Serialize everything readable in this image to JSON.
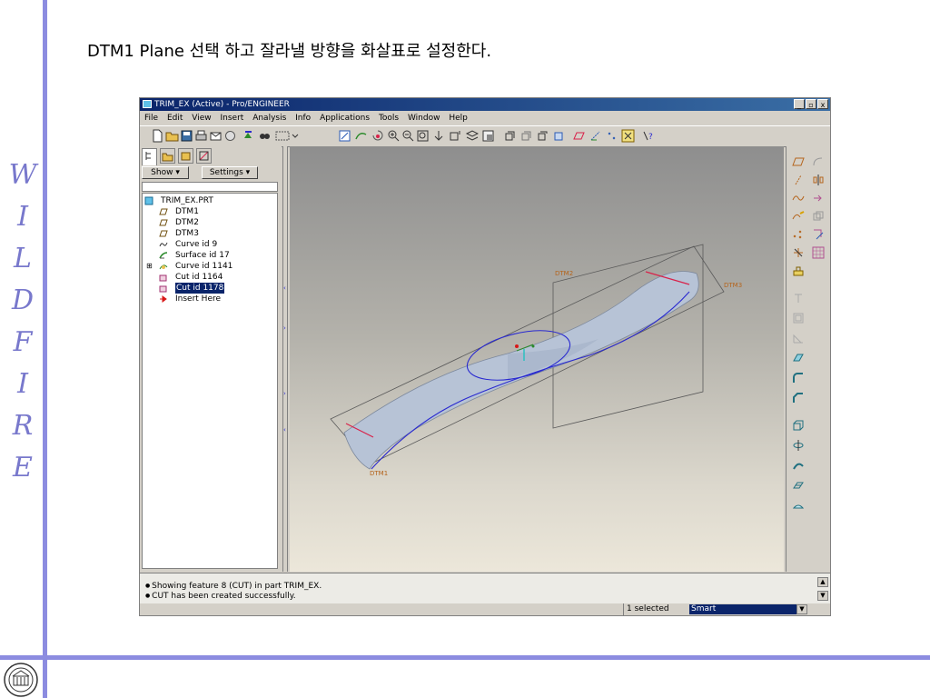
{
  "slide": {
    "title": "DTM1 Plane 선택 하고 잘라낼 방향을 화살표로 설정한다.",
    "side_letters": [
      "W",
      "I",
      "L",
      "D",
      "F",
      "I",
      "R",
      "E"
    ]
  },
  "window": {
    "title": "TRIM_EX (Active) - Pro/ENGINEER",
    "controls": [
      "_",
      "▫",
      "x"
    ],
    "menu": [
      "File",
      "Edit",
      "View",
      "Insert",
      "Analysis",
      "Info",
      "Applications",
      "Tools",
      "Window",
      "Help"
    ]
  },
  "panel": {
    "show_label": "Show",
    "settings_label": "Settings",
    "tree": [
      {
        "label": "TRIM_EX.PRT",
        "icon": "part-icon"
      },
      {
        "label": "DTM1",
        "icon": "datum-plane-icon"
      },
      {
        "label": "DTM2",
        "icon": "datum-plane-icon"
      },
      {
        "label": "DTM3",
        "icon": "datum-plane-icon"
      },
      {
        "label": "Curve id 9",
        "icon": "curve-icon"
      },
      {
        "label": "Surface id 17",
        "icon": "surface-icon"
      },
      {
        "label": "Curve id 1141",
        "icon": "curve-icon"
      },
      {
        "label": "Cut id 1164",
        "icon": "cut-icon"
      },
      {
        "label": "Cut id 1178",
        "icon": "cut-icon",
        "selected": true
      },
      {
        "label": "Insert Here",
        "icon": "insert-arrow-icon"
      }
    ]
  },
  "viewport": {
    "datum_labels": [
      "DTM2",
      "DTM3",
      "DTM1"
    ],
    "colors": {
      "surface": "#b7c3d6",
      "curve": "#2a2ad0",
      "datum_label": "#b5651d",
      "edge": "#d8224a"
    }
  },
  "messages": [
    "Showing feature 8 (CUT) in part TRIM_EX.",
    "CUT has been created successfully."
  ],
  "status": {
    "selected": "1 selected",
    "filter": "Smart"
  }
}
